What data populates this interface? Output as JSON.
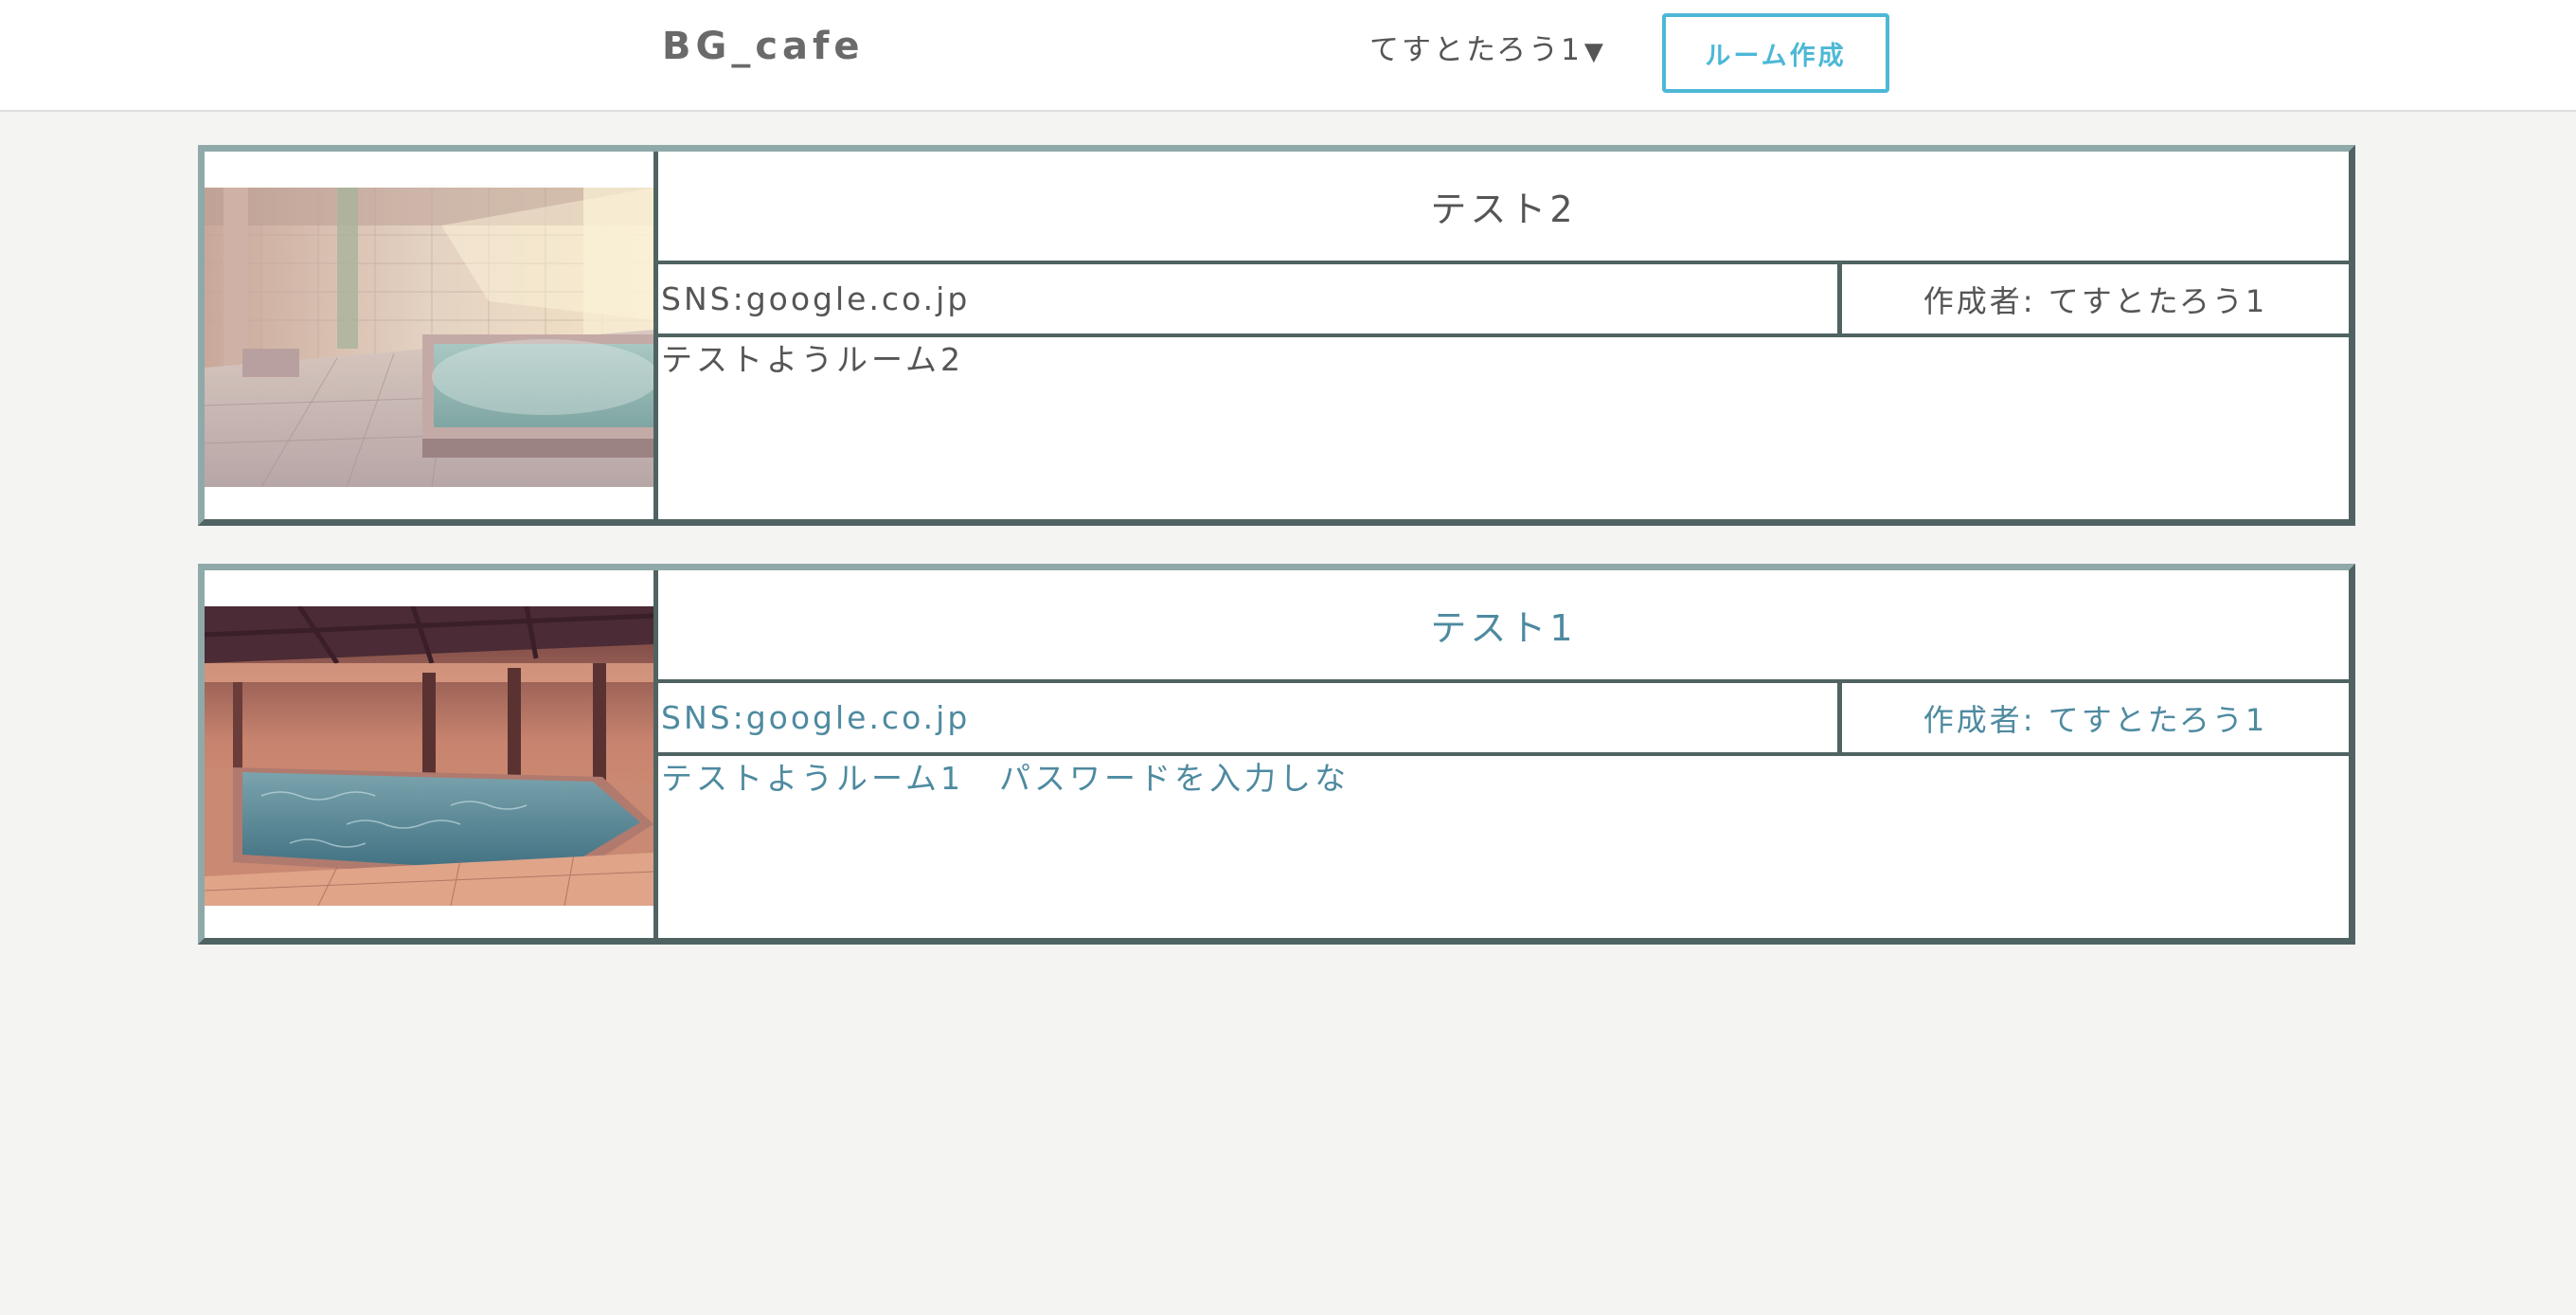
{
  "header": {
    "brand": "BG_cafe",
    "user_name": "てすとたろう1",
    "user_caret": "▼",
    "create_room_label": "ルーム作成"
  },
  "rooms": [
    {
      "title": "テスト2",
      "sns": "SNS:google.co.jp",
      "author": "作成者: てすとたろう1",
      "description": "テストようルーム2",
      "text_color": "#555555",
      "thumbnail": "sunlit-bathhouse-image"
    },
    {
      "title": "テスト1",
      "sns": "SNS:google.co.jp",
      "author": "作成者: てすとたろう1",
      "description": "テストようルーム1　パスワードを入力しな",
      "text_color": "#4e8aa0",
      "thumbnail": "wooden-bathhouse-image"
    }
  ],
  "colors": {
    "page_background": "#f4f4f2",
    "accent": "#4db8d6",
    "card_border_light": "#8fa9a9",
    "card_border_dark": "#4f6362"
  }
}
